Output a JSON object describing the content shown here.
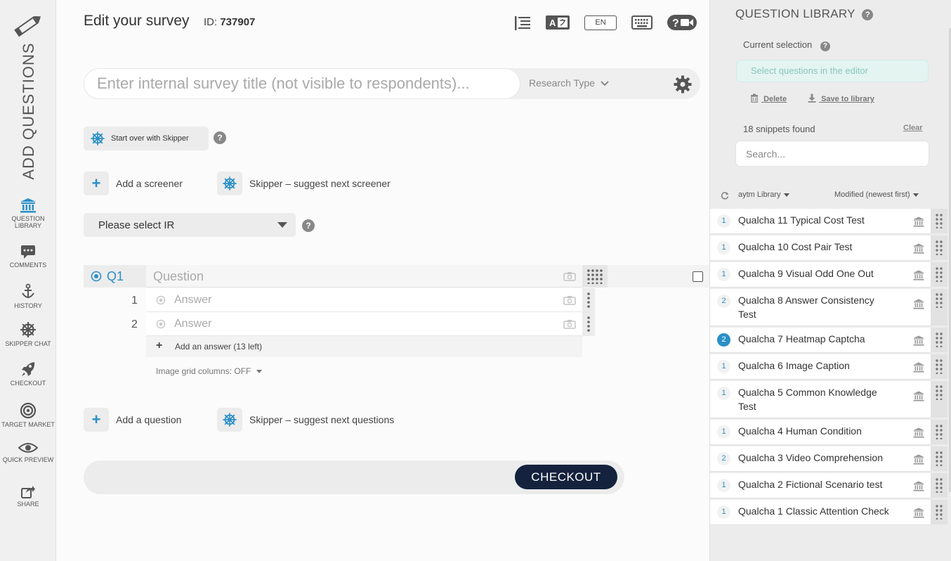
{
  "sidebar": {
    "add_questions": "ADD QUESTIONS",
    "items": [
      {
        "label": "QUESTION LIBRARY",
        "icon": "bank-icon"
      },
      {
        "label": "COMMENTS",
        "icon": "comments-icon"
      },
      {
        "label": "HISTORY",
        "icon": "anchor-icon"
      },
      {
        "label": "SKIPPER CHAT",
        "icon": "ship-wheel-icon"
      },
      {
        "label": "CHECKOUT",
        "icon": "rocket-icon"
      },
      {
        "label": "TARGET MARKET",
        "icon": "target-icon"
      },
      {
        "label": "QUICK PREVIEW",
        "icon": "eye-icon"
      },
      {
        "label": "SHARE",
        "icon": "share-icon"
      }
    ]
  },
  "header": {
    "title": "Edit your survey",
    "id_label": "ID:",
    "id_value": "737907",
    "lang": "EN"
  },
  "survey": {
    "title_placeholder": "Enter internal survey title (not visible to respondents)...",
    "research_type": "Research Type",
    "start_over": "Start over with Skipper",
    "add_screener": "Add a screener",
    "skipper_screener": "Skipper – suggest next screener",
    "select_ir": "Please select IR",
    "question": {
      "id": "Q1",
      "placeholder": "Question",
      "answers": [
        {
          "num": "1",
          "placeholder": "Answer"
        },
        {
          "num": "2",
          "placeholder": "Answer"
        }
      ],
      "add_answer": "Add an answer (13 left)",
      "image_grid": "Image grid columns: OFF"
    },
    "add_question": "Add a question",
    "skipper_questions": "Skipper – suggest next questions",
    "checkout": "CHECKOUT"
  },
  "library": {
    "title": "QUESTION LIBRARY",
    "current_selection": "Current selection",
    "select_hint": "Select questions in the editor",
    "delete": "Delete",
    "save": "Save to library",
    "found": "18 snippets found",
    "clear": "Clear",
    "search_placeholder": "Search...",
    "source": "aytm Library",
    "sort": "Modified (newest first)",
    "snippets": [
      {
        "count": "1",
        "name": "Qualcha 11 Typical Cost Test"
      },
      {
        "count": "1",
        "name": "Qualcha 10 Cost Pair Test"
      },
      {
        "count": "1",
        "name": "Qualcha 9 Visual Odd One Out"
      },
      {
        "count": "2",
        "name": "Qualcha 8 Answer Consistency Test"
      },
      {
        "count": "2",
        "name": "Qualcha 7 Heatmap Captcha"
      },
      {
        "count": "1",
        "name": "Qualcha 6 Image Caption"
      },
      {
        "count": "1",
        "name": "Qualcha 5 Common Knowledge Test"
      },
      {
        "count": "1",
        "name": "Qualcha 4 Human Condition"
      },
      {
        "count": "2",
        "name": "Qualcha 3 Video Comprehension"
      },
      {
        "count": "1",
        "name": "Qualcha 2 Fictional Scenario test"
      },
      {
        "count": "1",
        "name": "Qualcha 1 Classic Attention Check"
      }
    ]
  },
  "colors": {
    "accent": "#2a8fc7",
    "checkout_bg": "#14223d",
    "selection_bg": "#e3f4f1"
  }
}
